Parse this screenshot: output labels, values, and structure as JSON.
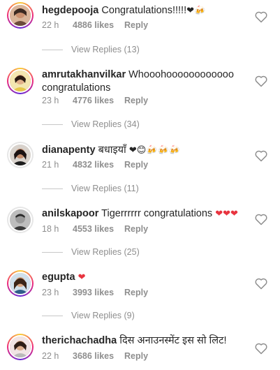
{
  "comments": [
    {
      "username": "hegdepooja",
      "text": "Congratulations!!!!!",
      "emojis": "❤🍻",
      "time": "22 h",
      "likes": "4886 likes",
      "reply": "Reply",
      "view_replies": "View Replies (13)"
    },
    {
      "username": "amrutakhanvilkar",
      "text": "Whooohoooooooooooo congratulations",
      "emojis": "",
      "time": "23 h",
      "likes": "4776 likes",
      "reply": "Reply",
      "view_replies": "View Replies (34)"
    },
    {
      "username": "dianapenty",
      "text": "बधाइयाँ",
      "emojis": "❤😊🍻🍻🍻",
      "time": "21 h",
      "likes": "4832 likes",
      "reply": "Reply",
      "view_replies": "View Replies (11)"
    },
    {
      "username": "anilskapoor",
      "text": "Tigerrrrrr congratulations",
      "emojis": "❤❤❤",
      "time": "18 h",
      "likes": "4553 likes",
      "reply": "Reply",
      "view_replies": "View Replies (25)"
    },
    {
      "username": "egupta",
      "text": "",
      "emojis": "❤",
      "time": "23 h",
      "likes": "3993 likes",
      "reply": "Reply",
      "view_replies": "View Replies (9)"
    },
    {
      "username": "therichachadha",
      "text": "दिस अनाउनस्मेंट इस सो लिट!",
      "emojis": "",
      "time": "22 h",
      "likes": "3686 likes",
      "reply": "Reply",
      "view_replies": ""
    }
  ]
}
